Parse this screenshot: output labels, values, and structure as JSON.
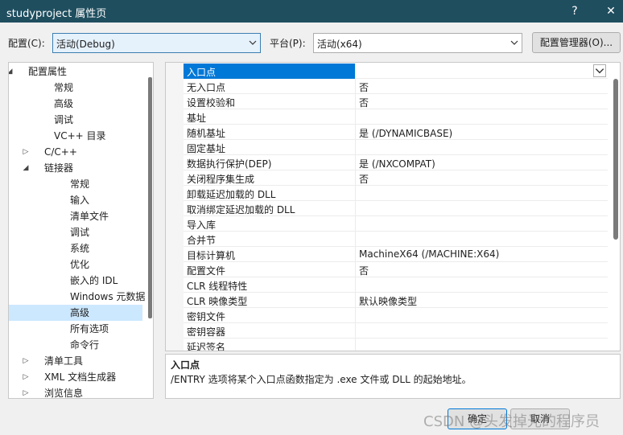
{
  "window": {
    "title": "studyproject 属性页",
    "help_label": "?",
    "close_label": "✕"
  },
  "toolbar": {
    "config_label": "配置(C):",
    "config_value": "活动(Debug)",
    "platform_label": "平台(P):",
    "platform_value": "活动(x64)",
    "config_manager_label": "配置管理器(O)..."
  },
  "tree": {
    "items": [
      {
        "label": "配置属性",
        "glyph": "◢",
        "indent": 0
      },
      {
        "label": "常规",
        "glyph": "",
        "indent": 2
      },
      {
        "label": "高级",
        "glyph": "",
        "indent": 2
      },
      {
        "label": "调试",
        "glyph": "",
        "indent": 2
      },
      {
        "label": "VC++ 目录",
        "glyph": "",
        "indent": 2
      },
      {
        "label": "C/C++",
        "glyph": "▷",
        "indent": 1
      },
      {
        "label": "链接器",
        "glyph": "◢",
        "indent": 1
      },
      {
        "label": "常规",
        "glyph": "",
        "indent": 3
      },
      {
        "label": "输入",
        "glyph": "",
        "indent": 3
      },
      {
        "label": "清单文件",
        "glyph": "",
        "indent": 3
      },
      {
        "label": "调试",
        "glyph": "",
        "indent": 3
      },
      {
        "label": "系统",
        "glyph": "",
        "indent": 3
      },
      {
        "label": "优化",
        "glyph": "",
        "indent": 3
      },
      {
        "label": "嵌入的 IDL",
        "glyph": "",
        "indent": 3
      },
      {
        "label": "Windows 元数据",
        "glyph": "",
        "indent": 3
      },
      {
        "label": "高级",
        "glyph": "",
        "indent": 3,
        "selected": true
      },
      {
        "label": "所有选项",
        "glyph": "",
        "indent": 3
      },
      {
        "label": "命令行",
        "glyph": "",
        "indent": 3
      },
      {
        "label": "清单工具",
        "glyph": "▷",
        "indent": 1
      },
      {
        "label": "XML 文档生成器",
        "glyph": "▷",
        "indent": 1
      },
      {
        "label": "浏览信息",
        "glyph": "▷",
        "indent": 1
      }
    ]
  },
  "grid": {
    "rows": [
      {
        "name": "入口点",
        "value": "",
        "selected": true
      },
      {
        "name": "无入口点",
        "value": "否"
      },
      {
        "name": "设置校验和",
        "value": "否"
      },
      {
        "name": "基址",
        "value": ""
      },
      {
        "name": "随机基址",
        "value": "是 (/DYNAMICBASE)"
      },
      {
        "name": "固定基址",
        "value": ""
      },
      {
        "name": "数据执行保护(DEP)",
        "value": "是 (/NXCOMPAT)"
      },
      {
        "name": "关闭程序集生成",
        "value": "否"
      },
      {
        "name": "卸载延迟加载的 DLL",
        "value": ""
      },
      {
        "name": "取消绑定延迟加载的 DLL",
        "value": ""
      },
      {
        "name": "导入库",
        "value": ""
      },
      {
        "name": "合并节",
        "value": ""
      },
      {
        "name": "目标计算机",
        "value": "MachineX64 (/MACHINE:X64)"
      },
      {
        "name": "配置文件",
        "value": "否"
      },
      {
        "name": "CLR 线程特性",
        "value": ""
      },
      {
        "name": "CLR 映像类型",
        "value": "默认映像类型"
      },
      {
        "name": "密钥文件",
        "value": ""
      },
      {
        "name": "密钥容器",
        "value": ""
      },
      {
        "name": "延迟签名",
        "value": ""
      }
    ]
  },
  "description": {
    "title": "入口点",
    "text": "/ENTRY 选项将某个入口点函数指定为 .exe 文件或 DLL 的起始地址。"
  },
  "footer": {
    "ok_label": "确定",
    "cancel_label": "取消"
  },
  "watermark": "CSDN @头发掉光的程序员"
}
